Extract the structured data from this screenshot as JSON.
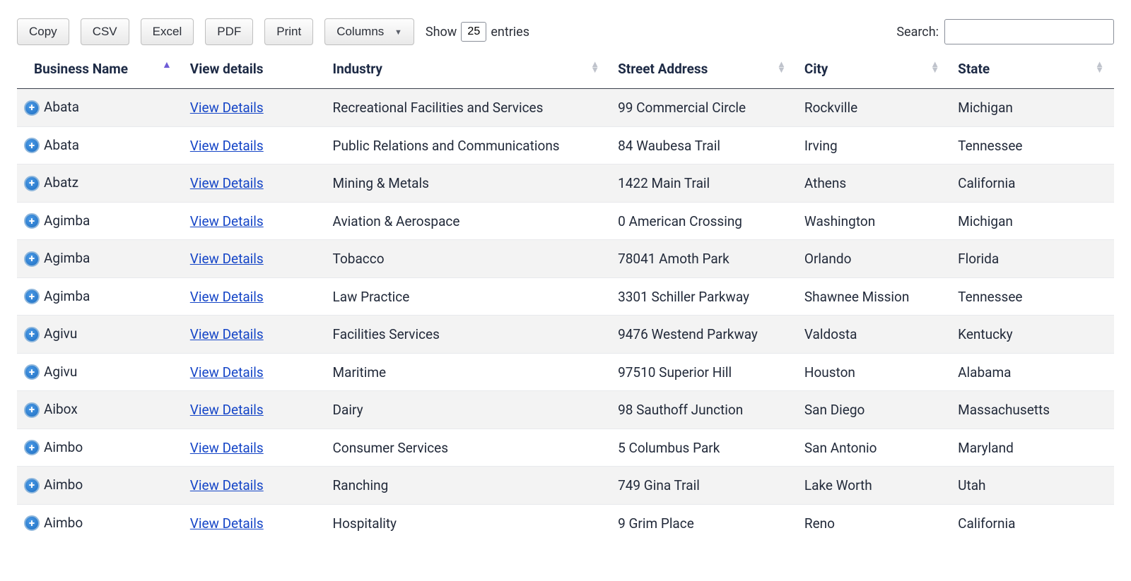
{
  "toolbar": {
    "copy_label": "Copy",
    "csv_label": "CSV",
    "excel_label": "Excel",
    "pdf_label": "PDF",
    "print_label": "Print",
    "columns_label": "Columns",
    "show_prefix": "Show",
    "show_suffix": "entries",
    "entries_value": "25",
    "search_label": "Search:",
    "search_value": ""
  },
  "columns": {
    "business_name": "Business Name",
    "view_details": "View details",
    "industry": "Industry",
    "street_address": "Street Address",
    "city": "City",
    "state": "State"
  },
  "details_label": "View Details",
  "rows": [
    {
      "name": "Abata",
      "industry": "Recreational Facilities and Services",
      "address": "99 Commercial Circle",
      "city": "Rockville",
      "state": "Michigan"
    },
    {
      "name": "Abata",
      "industry": "Public Relations and Communications",
      "address": "84 Waubesa Trail",
      "city": "Irving",
      "state": "Tennessee"
    },
    {
      "name": "Abatz",
      "industry": "Mining & Metals",
      "address": "1422 Main Trail",
      "city": "Athens",
      "state": "California"
    },
    {
      "name": "Agimba",
      "industry": "Aviation & Aerospace",
      "address": "0 American Crossing",
      "city": "Washington",
      "state": "Michigan"
    },
    {
      "name": "Agimba",
      "industry": "Tobacco",
      "address": "78041 Amoth Park",
      "city": "Orlando",
      "state": "Florida"
    },
    {
      "name": "Agimba",
      "industry": "Law Practice",
      "address": "3301 Schiller Parkway",
      "city": "Shawnee Mission",
      "state": "Tennessee"
    },
    {
      "name": "Agivu",
      "industry": "Facilities Services",
      "address": "9476 Westend Parkway",
      "city": "Valdosta",
      "state": "Kentucky"
    },
    {
      "name": "Agivu",
      "industry": "Maritime",
      "address": "97510 Superior Hill",
      "city": "Houston",
      "state": "Alabama"
    },
    {
      "name": "Aibox",
      "industry": "Dairy",
      "address": "98 Sauthoff Junction",
      "city": "San Diego",
      "state": "Massachusetts"
    },
    {
      "name": "Aimbo",
      "industry": "Consumer Services",
      "address": "5 Columbus Park",
      "city": "San Antonio",
      "state": "Maryland"
    },
    {
      "name": "Aimbo",
      "industry": "Ranching",
      "address": "749 Gina Trail",
      "city": "Lake Worth",
      "state": "Utah"
    },
    {
      "name": "Aimbo",
      "industry": "Hospitality",
      "address": "9 Grim Place",
      "city": "Reno",
      "state": "California"
    }
  ]
}
